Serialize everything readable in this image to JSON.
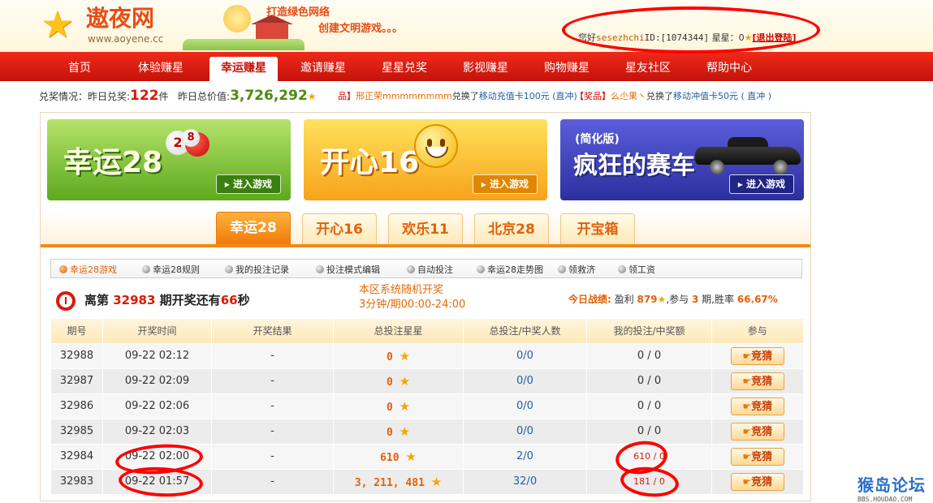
{
  "header": {
    "logo_text": "遨夜网",
    "domain": "www.aoyene.cc",
    "slogan_line1": "打造绿色网络",
    "slogan_line2": "创建文明游戏。。。",
    "user": {
      "greeting": "您好",
      "username": "sesezhchi",
      "id_label": "ID:",
      "id_value": "[1074344]",
      "stars_label": "星星：",
      "stars_value": "0",
      "logout": "[退出登陆]"
    }
  },
  "nav": {
    "items": [
      "首页",
      "体验赚星",
      "幸运赚星",
      "邀请赚星",
      "星星兑奖",
      "影视赚星",
      "购物赚星",
      "星友社区",
      "帮助中心"
    ],
    "active": "幸运赚星"
  },
  "exchange": {
    "label_yesterday": "兑奖情况：昨日兑奖:",
    "count": "122",
    "unit": "件",
    "label_total": "昨日总价值:",
    "total": "3,726,292"
  },
  "news": [
    {
      "tag": "品】",
      "name": "邢正荣mmmmmmmm",
      "action": "兑换了",
      "product": "移动充值卡100元 (直冲)"
    },
    {
      "tag": "【奖品】",
      "name": "么尐果丶",
      "action": "兑换了",
      "product": "移动冲值卡50元 ( 直冲 )"
    }
  ],
  "banners": [
    {
      "title": "幸运28",
      "button": "进入游戏"
    },
    {
      "title": "开心16",
      "button": "进入游戏"
    },
    {
      "subtitle": "(简化版)",
      "title": "疯狂的赛车",
      "button": "进入游戏"
    }
  ],
  "balls": [
    "2",
    "8"
  ],
  "game_tabs": [
    "幸运28",
    "开心16",
    "欢乐11",
    "北京28",
    "开宝箱"
  ],
  "sub_nav": [
    "幸运28游戏",
    "幸运28规则",
    "我的投注记录",
    "投注模式编辑",
    "自动投注",
    "幸运28走势图",
    "领救济",
    "领工资"
  ],
  "countdown": {
    "prefix": "离第",
    "period": "32983",
    "middle": "期开奖还有",
    "seconds": "66",
    "suffix": "秒"
  },
  "system": {
    "line1": "本区系统随机开奖",
    "line2": "3分钟/期00:00-24:00"
  },
  "today": {
    "label": "今日战绩:",
    "profit_label": "盈利",
    "profit": "879",
    "join_label": ",参与",
    "join": "3",
    "join_unit": "期,胜率",
    "rate": "66.67%"
  },
  "table": {
    "headers": [
      "期号",
      "开奖时间",
      "开奖结果",
      "总投注星星",
      "总投注/中奖人数",
      "我的投注/中奖额",
      "参与"
    ],
    "rows": [
      {
        "period": "32988",
        "time": "09-22 02:12",
        "result": "-",
        "total": "0",
        "people": "0/0",
        "mine": "0 / 0",
        "action": "竞猜"
      },
      {
        "period": "32987",
        "time": "09-22 02:09",
        "result": "-",
        "total": "0",
        "people": "0/0",
        "mine": "0 / 0",
        "action": "竞猜"
      },
      {
        "period": "32986",
        "time": "09-22 02:06",
        "result": "-",
        "total": "0",
        "people": "0/0",
        "mine": "0 / 0",
        "action": "竞猜"
      },
      {
        "period": "32985",
        "time": "09-22 02:03",
        "result": "-",
        "total": "0",
        "people": "0/0",
        "mine": "0 / 0",
        "action": "竞猜"
      },
      {
        "period": "32984",
        "time": "09-22 02:00",
        "result": "-",
        "total": "610",
        "people": "2/0",
        "mine": "610 / 0",
        "action": "竞猜"
      },
      {
        "period": "32983",
        "time": "09-22 01:57",
        "result": "-",
        "total": "3, 211, 481",
        "people": "32/0",
        "mine": "181 / 0",
        "action": "竞猜"
      }
    ]
  },
  "watermark": {
    "text": "猴岛论坛",
    "sub": "BBS.HOUDAO.COM"
  },
  "colors": {
    "nav_red": "#d8190c",
    "accent_orange": "#f08a18",
    "link_blue": "#1f5fa8",
    "annotation_red": "#ff0000"
  }
}
